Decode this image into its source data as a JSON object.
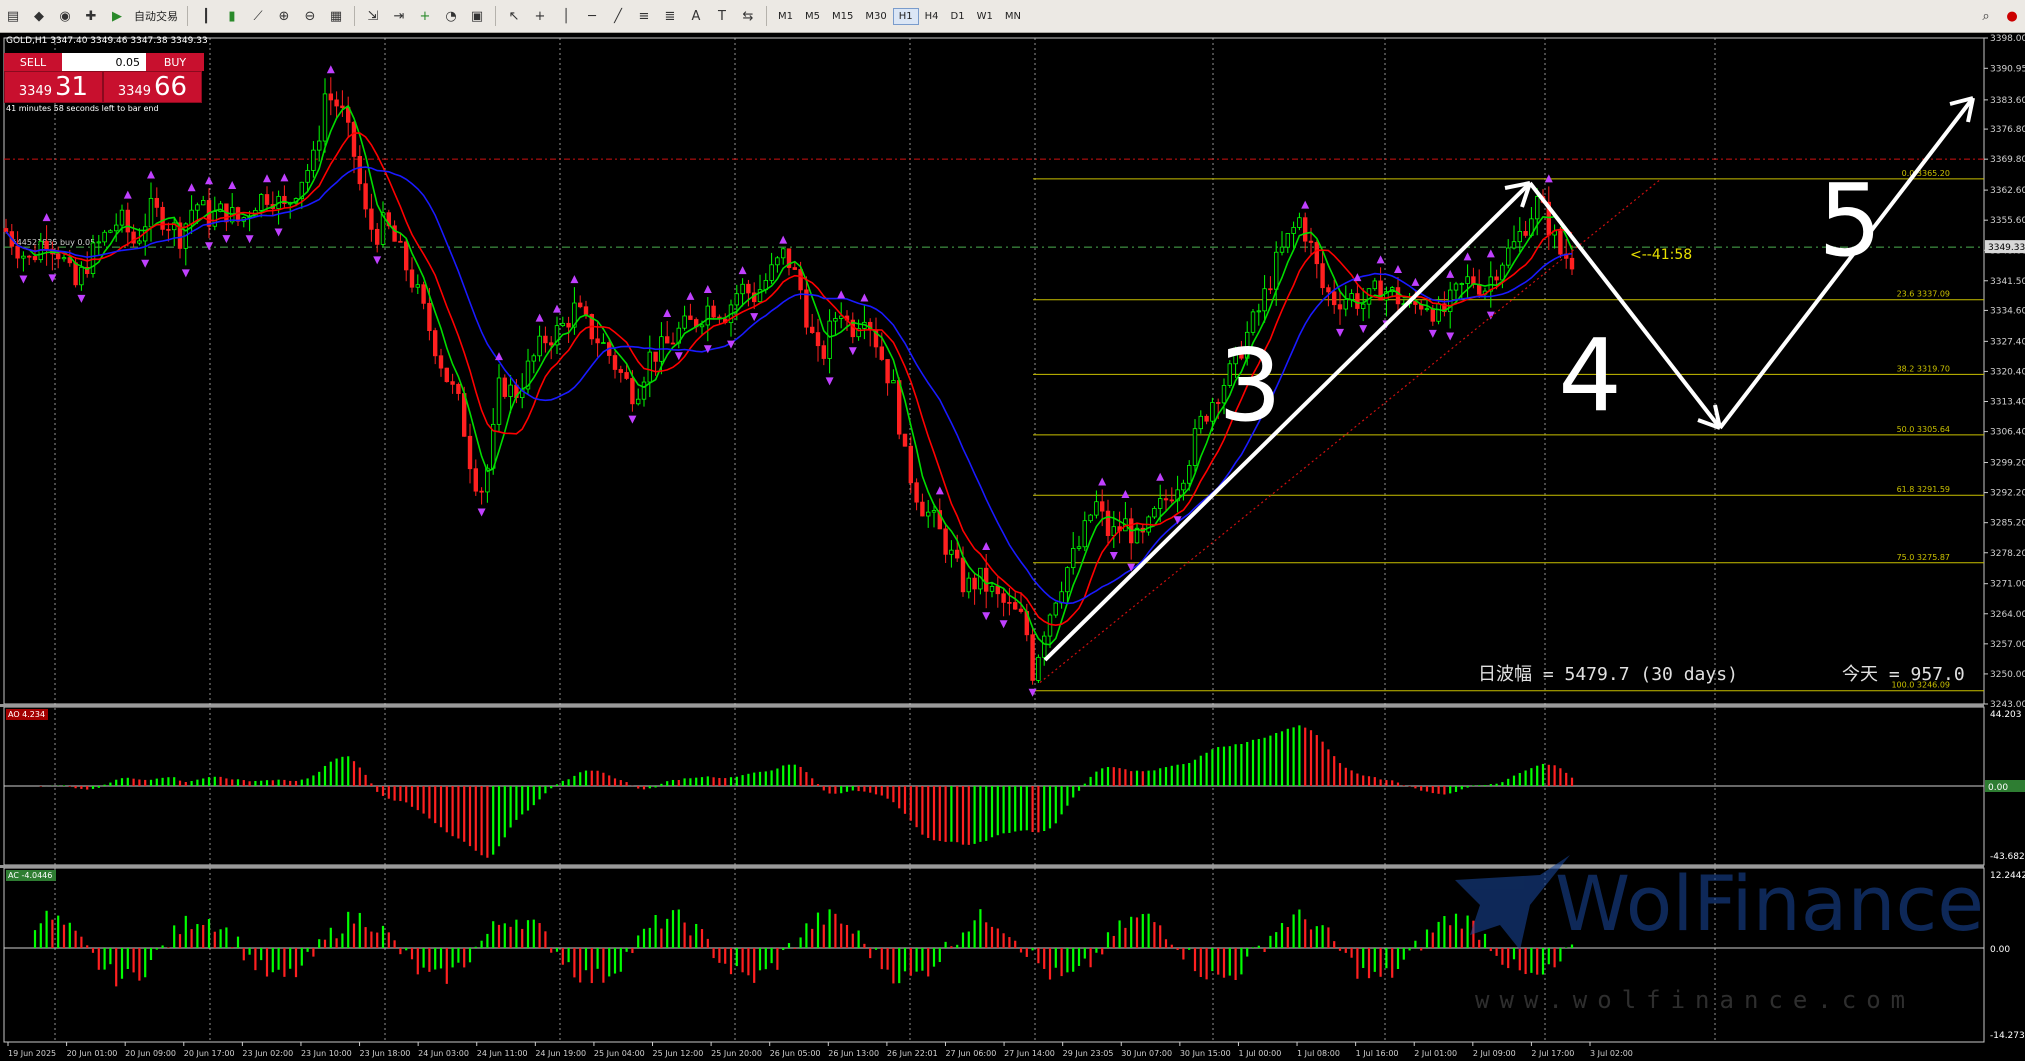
{
  "toolbar": {
    "auto_trade_label": "自动交易",
    "timeframes": [
      "M1",
      "M5",
      "M15",
      "M30",
      "H1",
      "H4",
      "D1",
      "W1",
      "MN"
    ],
    "active_timeframe": "H1"
  },
  "symbol": {
    "ticker_line": "GOLD,H1  3347.40 3349.46 3347.38 3349.33",
    "sell_label": "SELL",
    "buy_label": "BUY",
    "lot": "0.05",
    "bid_small": "3349",
    "bid_big": "31",
    "ask_small": "3349",
    "ask_big": "66",
    "timer_text": "41 minutes 58 seconds left to bar end",
    "countdown": "<--41:58",
    "current_price": "3349.33",
    "order_label": "#44521835 buy 0.05",
    "order_tag": "#44521835"
  },
  "chart_data": {
    "type": "candlestick",
    "price_axis": [
      "3398.00",
      "3390.95",
      "3383.60",
      "3376.80",
      "3369.80",
      "3362.60",
      "3355.60",
      "3348.60",
      "3341.50",
      "3334.60",
      "3327.40",
      "3320.40",
      "3313.40",
      "3306.40",
      "3299.20",
      "3292.20",
      "3285.20",
      "3278.20",
      "3271.00",
      "3264.00",
      "3257.00",
      "3250.00",
      "3243.00"
    ],
    "price_range": [
      3243.0,
      3398.0
    ],
    "time_axis": [
      "19 Jun 2025",
      "20 Jun 01:00",
      "20 Jun 09:00",
      "20 Jun 17:00",
      "23 Jun 02:00",
      "23 Jun 10:00",
      "23 Jun 18:00",
      "24 Jun 03:00",
      "24 Jun 11:00",
      "24 Jun 19:00",
      "25 Jun 04:00",
      "25 Jun 12:00",
      "25 Jun 20:00",
      "26 Jun 05:00",
      "26 Jun 13:00",
      "26 Jun 22:01",
      "27 Jun 06:00",
      "27 Jun 14:00",
      "29 Jun 23:05",
      "30 Jun 07:00",
      "30 Jun 15:00",
      "1 Jul 00:00",
      "1 Jul 08:00",
      "1 Jul 16:00",
      "2 Jul 01:00",
      "2 Jul 09:00",
      "2 Jul 17:00",
      "3 Jul 02:00"
    ],
    "fibonacci": [
      {
        "level": "0.0",
        "price": 3365.2
      },
      {
        "level": "23.6",
        "price": 3337.09
      },
      {
        "level": "38.2",
        "price": 3319.7
      },
      {
        "level": "50.0",
        "price": 3305.64
      },
      {
        "level": "61.8",
        "price": 3291.59
      },
      {
        "level": "75.0",
        "price": 3275.87
      },
      {
        "level": "100.0",
        "price": 3246.09
      }
    ],
    "high_line": 3369.8,
    "wave_labels": [
      "3",
      "4",
      "5"
    ],
    "daily_range_text": "日波幅 = 5479.7  (30 days)",
    "today_text": "今天 = 957.0",
    "ao": {
      "label": "AO 4.234",
      "max": "44.203",
      "zero": "0.00",
      "min": "-43.682"
    },
    "ac": {
      "label": "AC -4.0446",
      "max": "12.2442",
      "zero": "0.00",
      "min": "-14.2731"
    },
    "colors": {
      "up": "#00ff00",
      "down": "#ff2020",
      "ma_fast": "#00dd00",
      "ma_mid": "#ff0000",
      "ma_slow": "#1a1aff",
      "fib": "#c9c000",
      "grid": "#d0d0d0"
    }
  },
  "watermark": {
    "brand": "WolFinance",
    "url": "www.wolfinance.com"
  }
}
